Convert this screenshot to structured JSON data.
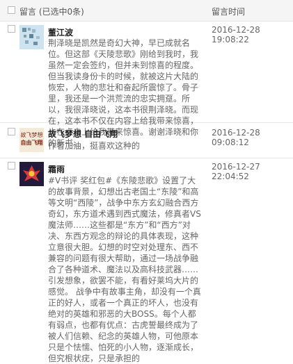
{
  "header": {
    "col_comment": "留言",
    "col_count": "(已选中0条)",
    "col_time": "留言时间"
  },
  "comments": [
    {
      "name": "董江波",
      "time": "2016-12-28 19:08:22",
      "text": "荆泽晓是凯然是奇幻大神，早已成就名位。但这部《天陵悲歌》刚给到我时，我虽然一定会签约，但并未到惊喜的程度。但当我读身份卡的时候，就被这片大陆的恢宏，人物的悲壮和奋起所震惊了。骨子里，我还是一个洪荒流的忠实拥趸。所以，我很泽晓说，这本书很荆泽晓。而现在，这本书不仅在内容上给我带来惊喜，也在点击上给我带来惊喜。谢谢泽晓和你的新书。"
    },
    {
      "name": "故飞梦想 自由飞翔",
      "time": "2016-12-28 09:08:12",
      "text": "作者加油，挺喜欢这种的"
    },
    {
      "name": "霜雨",
      "time": "2016-12-27 22:04:52",
      "text": "#V书评 奖红包#《东陵悲歌》设置了大的故事背景，幻想出古老国土“东陵”和高等文明“西陵”，战争中东方玄幻融合西方奇幻，东方道术遇到西式魔法，修真者VS魔法师……这些都是“东方”和“西方”对决、东西方观念的辩论的具体表现，这种立意很大胆。幻想的时空对处理东、西不兼容的问题有很大帮助，通过一场战争融合了各种道术、魔法以及高科技武器……引发想象，欲罢不能，有看好莱坞大片的感觉。 战争中有故事主角，却没有一个真正的好人，或者一个真正的坏人，也没有绝对的英雄和邪恶的大BOSS。每个人都有弱点，也都有优点：古虎誓最终成为了被人们信赖、纪念的英雄人物，可他原本只是个怯懦、怕死的小人物，逐渐成长，但究根状疣，只是承担的"
    }
  ],
  "avatars": {
    "a1_label": "",
    "a2_label": "故飞梦想",
    "a2_sub": "自由飞翔"
  }
}
